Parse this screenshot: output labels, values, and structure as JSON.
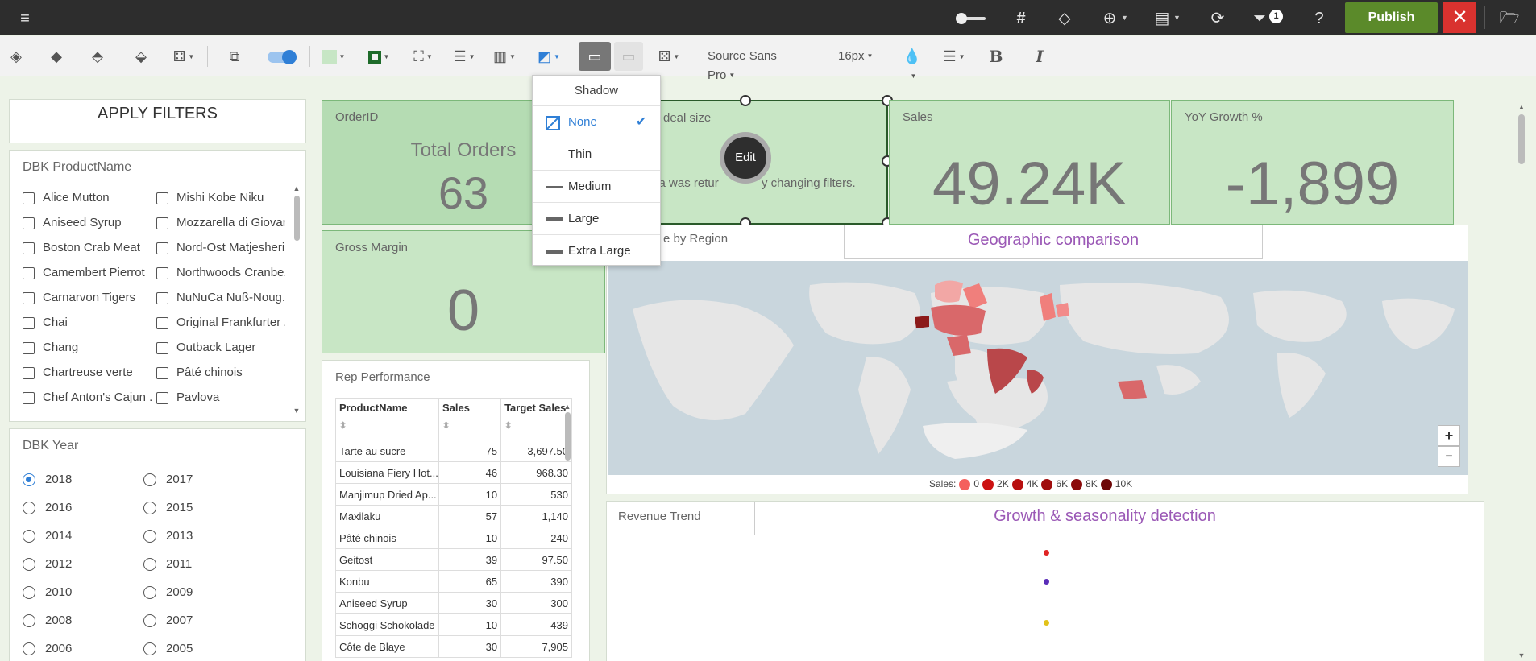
{
  "topbar": {
    "menu_icon": "hamburger-icon",
    "filter_badge": "1",
    "publish_label": "Publish"
  },
  "toolbar": {
    "font_name": "Source Sans Pro",
    "font_size": "16px",
    "bold_label": "B",
    "italic_label": "I"
  },
  "filters": {
    "apply_label": "APPLY FILTERS",
    "product_title": "DBK ProductName",
    "products_col1": [
      "Alice Mutton",
      "Aniseed Syrup",
      "Boston Crab Meat",
      "Camembert Pierrot",
      "Carnarvon Tigers",
      "Chai",
      "Chang",
      "Chartreuse verte",
      "Chef Anton's Cajun ..."
    ],
    "products_col2": [
      "Mishi Kobe Niku",
      "Mozzarella di Giovan",
      "Nord-Ost Matjesheri...",
      "Northwoods Cranbe...",
      "NuNuCa Nuß-Noug...",
      "Original Frankfurter ...",
      "Outback Lager",
      "Pâté chinois",
      "Pavlova"
    ],
    "year_title": "DBK Year",
    "years_col1": [
      "2018",
      "2016",
      "2014",
      "2012",
      "2010",
      "2008",
      "2006"
    ],
    "years_col2": [
      "2017",
      "2015",
      "2013",
      "2011",
      "2009",
      "2007",
      "2005"
    ],
    "selected_year": "2018"
  },
  "kpis": {
    "orders": {
      "label": "OrderID",
      "subtitle": "Total Orders",
      "value": "63"
    },
    "deal": {
      "label": "deal size",
      "message": "ata was retur",
      "message2": "y changing filters."
    },
    "sales": {
      "label": "Sales",
      "value": "49.24K"
    },
    "yoy": {
      "label": "YoY Growth %",
      "value": "-1,899"
    },
    "margin": {
      "label": "Gross Margin",
      "value": "0"
    }
  },
  "edit_label": "Edit",
  "shadow_menu": {
    "title": "Shadow",
    "options": [
      "None",
      "Thin",
      "Medium",
      "Large",
      "Extra Large"
    ],
    "selected": "None"
  },
  "map": {
    "panel_title": "e by Region",
    "banner": "Geographic comparison",
    "zoom_in": "+",
    "zoom_out": "−",
    "legend_label": "Sales:",
    "legend_values": [
      "0",
      "2K",
      "4K",
      "6K",
      "8K",
      "10K"
    ],
    "legend_colors": [
      "#f4605d",
      "#cc1111",
      "#b81010",
      "#a00d0d",
      "#8b0a0a",
      "#6d0606"
    ]
  },
  "rep": {
    "title": "Rep Performance",
    "columns": [
      "ProductName",
      "Sales",
      "Target Sales"
    ],
    "rows": [
      [
        "Tarte au sucre",
        "75",
        "3,697.50"
      ],
      [
        "Louisiana Fiery Hot...",
        "46",
        "968.30"
      ],
      [
        "Manjimup Dried Ap...",
        "10",
        "530"
      ],
      [
        "Maxilaku",
        "57",
        "1,140"
      ],
      [
        "Pâté chinois",
        "10",
        "240"
      ],
      [
        "Geitost",
        "39",
        "97.50"
      ],
      [
        "Konbu",
        "65",
        "390"
      ],
      [
        "Aniseed Syrup",
        "30",
        "300"
      ],
      [
        "Schoggi Schokolade",
        "10",
        "439"
      ],
      [
        "Côte de Blaye",
        "30",
        "7,905"
      ]
    ]
  },
  "revenue": {
    "title": "Revenue Trend",
    "banner": "Growth & seasonality detection",
    "dot_colors": [
      "#e02424",
      "#5a2db8",
      "#e2c21a"
    ]
  }
}
